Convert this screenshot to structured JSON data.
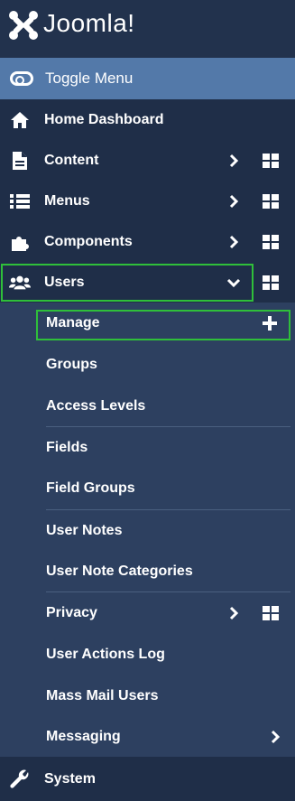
{
  "brand": {
    "name": "Joomla!"
  },
  "toggle": {
    "label": "Toggle Menu"
  },
  "menu": {
    "home": "Home Dashboard",
    "content": "Content",
    "menus": "Menus",
    "components": "Components",
    "users": "Users",
    "system": "System"
  },
  "users_submenu": {
    "manage": "Manage",
    "groups": "Groups",
    "access_levels": "Access Levels",
    "fields": "Fields",
    "field_groups": "Field Groups",
    "user_notes": "User Notes",
    "user_note_categories": "User Note Categories",
    "privacy": "Privacy",
    "user_actions_log": "User Actions Log",
    "mass_mail_users": "Mass Mail Users",
    "messaging": "Messaging"
  },
  "colors": {
    "sidebar_bg": "#2b3d5c",
    "header_bg": "#22324d",
    "toggle_bg": "#5379a9",
    "highlight": "#2fbf3a"
  }
}
